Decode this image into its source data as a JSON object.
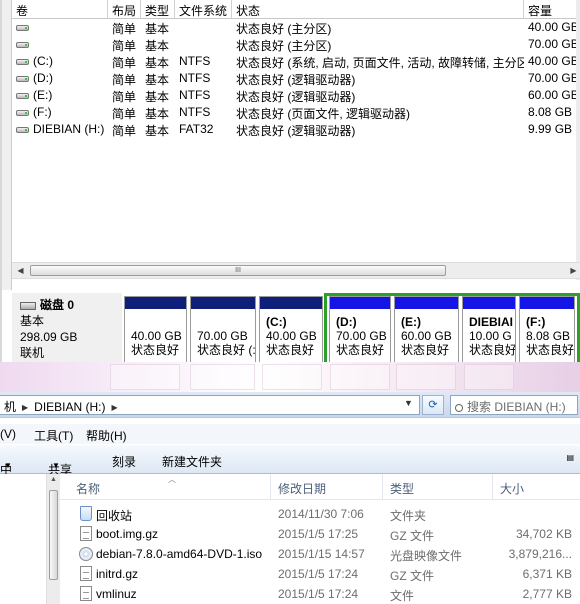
{
  "volume_table": {
    "columns": [
      "卷",
      "布局",
      "类型",
      "文件系统",
      "状态",
      "容量"
    ],
    "rows": [
      {
        "volume": "",
        "layout": "简单",
        "type": "基本",
        "fs": "",
        "status": "状态良好 (主分区)",
        "capacity": "40.00 GB"
      },
      {
        "volume": "",
        "layout": "简单",
        "type": "基本",
        "fs": "",
        "status": "状态良好 (主分区)",
        "capacity": "70.00 GB"
      },
      {
        "volume": "(C:)",
        "layout": "简单",
        "type": "基本",
        "fs": "NTFS",
        "status": "状态良好 (系统, 启动, 页面文件, 活动, 故障转储, 主分区)",
        "capacity": "40.00 GB"
      },
      {
        "volume": "(D:)",
        "layout": "简单",
        "type": "基本",
        "fs": "NTFS",
        "status": "状态良好 (逻辑驱动器)",
        "capacity": "70.00 GB"
      },
      {
        "volume": "(E:)",
        "layout": "简单",
        "type": "基本",
        "fs": "NTFS",
        "status": "状态良好 (逻辑驱动器)",
        "capacity": "60.00 GB"
      },
      {
        "volume": "(F:)",
        "layout": "简单",
        "type": "基本",
        "fs": "NTFS",
        "status": "状态良好 (页面文件, 逻辑驱动器)",
        "capacity": "8.08 GB"
      },
      {
        "volume": "DIEBIAN (H:)",
        "layout": "简单",
        "type": "基本",
        "fs": "FAT32",
        "status": "状态良好 (逻辑驱动器)",
        "capacity": "9.99 GB"
      }
    ],
    "scroll_thumb_label": "III"
  },
  "disk": {
    "name": "磁盘 0",
    "type": "基本",
    "size": "298.09 GB",
    "state": "联机",
    "partitions": [
      {
        "name": "",
        "capacity": "40.00 GB",
        "status": "状态良好"
      },
      {
        "name": "",
        "capacity": "70.00 GB",
        "status": "状态良好 (:"
      },
      {
        "name": "(C:)",
        "capacity": "40.00 GB",
        "status": "状态良好"
      },
      {
        "name": "(D:)",
        "capacity": "70.00 GB",
        "status": "状态良好"
      },
      {
        "name": "(E:)",
        "capacity": "60.00 GB",
        "status": "状态良好"
      },
      {
        "name": "DIEBIAI",
        "capacity": "10.00 G",
        "status": "状态良好"
      },
      {
        "name": "(F:)",
        "capacity": "8.08 GB",
        "status": "状态良好"
      }
    ]
  },
  "explorer": {
    "address": {
      "prefix": "机",
      "current": "DIEBIAN (H:)"
    },
    "search_placeholder": "搜索 DIEBIAN (H:)",
    "menu": [
      "(V)",
      "工具(T)",
      "帮助(H)"
    ],
    "toolbar": [
      "中",
      "共享",
      "刻录",
      "新建文件夹"
    ],
    "columns": {
      "name": "名称",
      "date": "修改日期",
      "type": "类型",
      "size": "大小"
    },
    "files": [
      {
        "name": "回收站",
        "date": "2014/11/30 7:06",
        "type": "文件夹",
        "size": "",
        "icon": "recycle-bin-icon"
      },
      {
        "name": "boot.img.gz",
        "date": "2015/1/5 17:25",
        "type": "GZ 文件",
        "size": "34,702 KB",
        "icon": "file-icon"
      },
      {
        "name": "debian-7.8.0-amd64-DVD-1.iso",
        "date": "2015/1/15 14:57",
        "type": "光盘映像文件",
        "size": "3,879,216...",
        "icon": "disc-image-icon"
      },
      {
        "name": "initrd.gz",
        "date": "2015/1/5 17:24",
        "type": "GZ 文件",
        "size": "6,371 KB",
        "icon": "file-icon"
      },
      {
        "name": "vmlinuz",
        "date": "2015/1/5 17:24",
        "type": "文件",
        "size": "2,777 KB",
        "icon": "file-icon"
      }
    ]
  }
}
